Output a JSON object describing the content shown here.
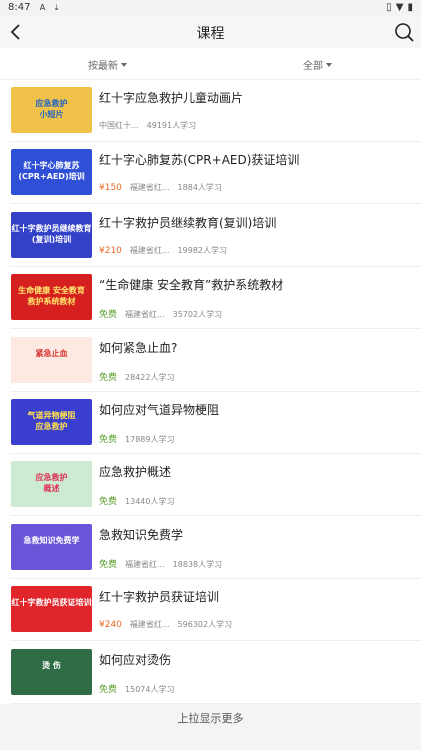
{
  "status_bar": {
    "time": "8:47"
  },
  "header": {
    "title": "课程"
  },
  "filters": {
    "sort_label": "按最新",
    "category_label": "全部"
  },
  "courses": [
    {
      "title": "红十字应急救护儿童动画片",
      "price": "",
      "price_type": "none",
      "provider": "中国红十...",
      "learners": "49191人学习",
      "thumb_text": "应急救护\n小短片",
      "thumb_bg": "#f0c24a",
      "thumb_color": "#1e62c4"
    },
    {
      "title": "红十字心肺复苏(CPR+AED)获证培训",
      "price": "¥150",
      "price_type": "paid",
      "provider": "福建省红...",
      "learners": "1884人学习",
      "thumb_text": "红十字心肺复苏\n(CPR+AED)培训",
      "thumb_bg": "#2f4fd6",
      "thumb_color": "#ffffff"
    },
    {
      "title": "红十字救护员继续教育(复训)培训",
      "price": "¥210",
      "price_type": "paid",
      "provider": "福建省红...",
      "learners": "19982人学习",
      "thumb_text": "红十字救护员继续教育\n(复训)培训",
      "thumb_bg": "#3340c8",
      "thumb_color": "#ffffff"
    },
    {
      "title": "“生命健康 安全教育”救护系统教材",
      "price": "免费",
      "price_type": "free",
      "provider": "福建省红...",
      "learners": "35702人学习",
      "thumb_text": "生命健康 安全教育\n救护系统教材",
      "thumb_bg": "#d62020",
      "thumb_color": "#ffe36b"
    },
    {
      "title": "如何紧急止血?",
      "price": "免费",
      "price_type": "free",
      "provider": "",
      "learners": "28422人学习",
      "thumb_text": "紧急止血",
      "thumb_bg": "#fde9e2",
      "thumb_color": "#d6322d"
    },
    {
      "title": "如何应对气道异物梗阻",
      "price": "免费",
      "price_type": "free",
      "provider": "",
      "learners": "17889人学习",
      "thumb_text": "气道异物梗阻\n应急救护",
      "thumb_bg": "#3b3fd0",
      "thumb_color": "#ffe14d"
    },
    {
      "title": "应急救护概述",
      "price": "免费",
      "price_type": "free",
      "provider": "",
      "learners": "13440人学习",
      "thumb_text": "应急救护\n概述",
      "thumb_bg": "#cdebd3",
      "thumb_color": "#e03358"
    },
    {
      "title": "急救知识免费学",
      "price": "免费",
      "price_type": "free",
      "provider": "福建省红...",
      "learners": "18838人学习",
      "thumb_text": "急救知识免费学",
      "thumb_bg": "#6a54d8",
      "thumb_color": "#ffffff"
    },
    {
      "title": "红十字救护员获证培训",
      "price": "¥240",
      "price_type": "paid",
      "provider": "福建省红...",
      "learners": "596302人学习",
      "thumb_text": "红十字救护员获证培训",
      "thumb_bg": "#e0262a",
      "thumb_color": "#ffffff"
    },
    {
      "title": "如何应对烫伤",
      "price": "免费",
      "price_type": "free",
      "provider": "",
      "learners": "15074人学习",
      "thumb_text": "烫 伤",
      "thumb_bg": "#2f6b45",
      "thumb_color": "#ffffff"
    }
  ],
  "footer": {
    "load_more": "上拉显示更多"
  }
}
